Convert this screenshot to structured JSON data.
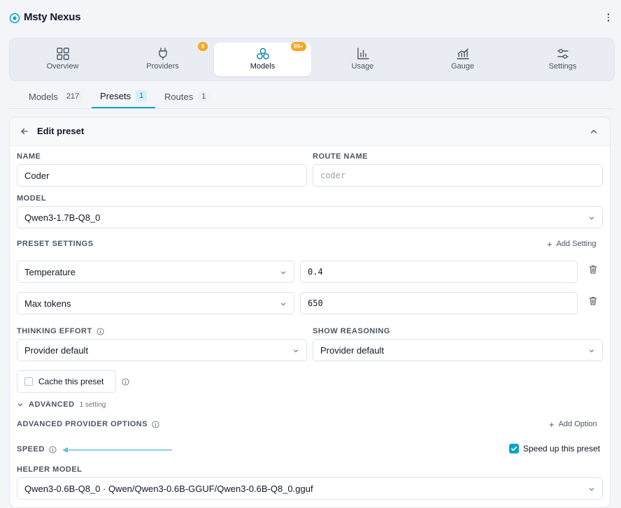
{
  "app": {
    "title": "Msty Nexus"
  },
  "nav": [
    {
      "label": "Overview",
      "icon": "grid-icon",
      "badge": ""
    },
    {
      "label": "Providers",
      "icon": "plug-icon",
      "badge": "9"
    },
    {
      "label": "Models",
      "icon": "models-icon",
      "badge": "99+",
      "active": true
    },
    {
      "label": "Usage",
      "icon": "bar-chart-icon",
      "badge": ""
    },
    {
      "label": "Gauge",
      "icon": "line-chart-icon",
      "badge": ""
    },
    {
      "label": "Settings",
      "icon": "sliders-icon",
      "badge": ""
    }
  ],
  "tabs": [
    {
      "label": "Models",
      "count": "217"
    },
    {
      "label": "Presets",
      "count": "1",
      "active": true
    },
    {
      "label": "Routes",
      "count": "1"
    }
  ],
  "form": {
    "title": "Edit preset",
    "name_label": "NAME",
    "name_value": "Coder",
    "route_label": "ROUTE NAME",
    "route_placeholder": "coder",
    "model_label": "MODEL",
    "model_value": "Qwen3-1.7B-Q8_0",
    "preset_settings_label": "PRESET SETTINGS",
    "add_setting": "Add Setting",
    "settings": [
      {
        "name": "Temperature",
        "value": "0.4"
      },
      {
        "name": "Max tokens",
        "value": "650"
      }
    ],
    "thinking_label": "THINKING EFFORT",
    "thinking_value": "Provider default",
    "reasoning_label": "SHOW REASONING",
    "reasoning_value": "Provider default",
    "cache_label": "Cache this preset",
    "cache_checked": false,
    "advanced_label": "ADVANCED",
    "advanced_count": "1 setting",
    "adv_provider_label": "ADVANCED PROVIDER OPTIONS",
    "add_option": "Add Option",
    "speed_label": "SPEED",
    "speed_check_label": "Speed up this preset",
    "speed_checked": true,
    "helper_label": "HELPER MODEL",
    "helper_value": "Qwen3-0.6B-Q8_0 · Qwen/Qwen3-0.6B-GGUF/Qwen3-0.6B-Q8_0.gguf"
  },
  "colors": {
    "accent": "#0ea5c6",
    "badge": "#f5a623"
  }
}
